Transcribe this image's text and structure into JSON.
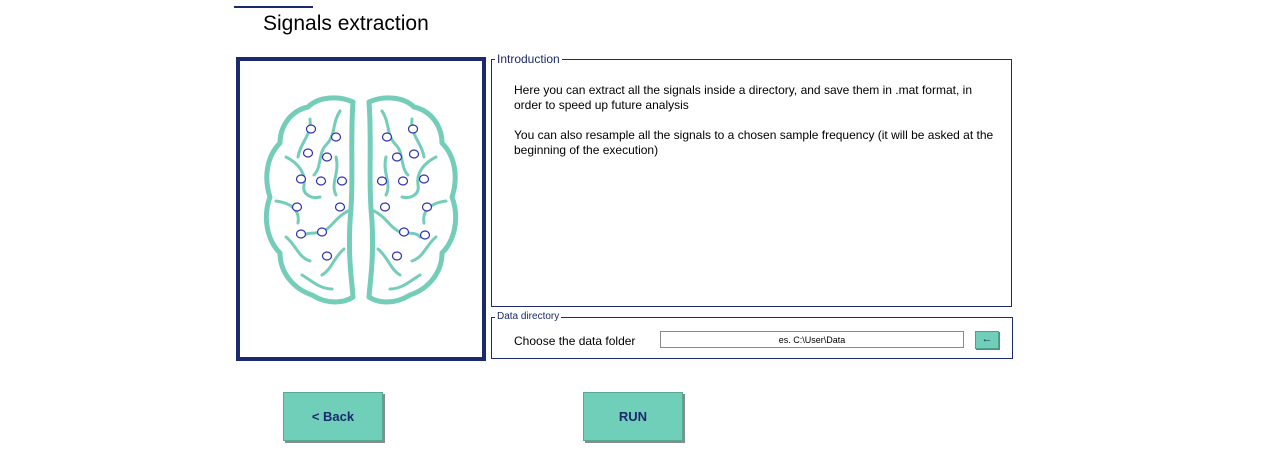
{
  "page": {
    "title": "Signals extraction"
  },
  "introduction": {
    "legend": "Introduction",
    "paragraph1": "Here you can extract all the signals inside a directory, and save them in .mat format, in order to speed up future analysis",
    "paragraph2": "You can also resample all the signals to a chosen sample frequency (it will be asked at the beginning of the execution)"
  },
  "data_directory": {
    "legend": "Data directory",
    "label": "Choose the data folder",
    "input_placeholder": "es. C:\\User\\Data",
    "input_value": "",
    "browse_icon": "left-arrow-icon",
    "browse_symbol": "←"
  },
  "buttons": {
    "back_label": "<  Back",
    "run_label": "RUN"
  },
  "colors": {
    "accent": "#6fcfb8",
    "navy": "#1a2a6c",
    "brain_stroke": "#74cdb9",
    "electrode": "#2b2fb0"
  },
  "image": {
    "icon": "brain-electrodes-icon"
  }
}
